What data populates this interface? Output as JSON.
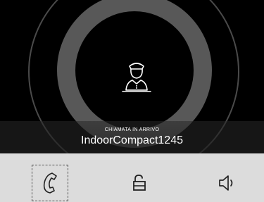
{
  "call": {
    "status_label": "CHIAMATA IN ARRIVO",
    "caller_name": "IndoorCompact1245"
  },
  "actions": {
    "answer_icon": "phone-handset-icon",
    "unlock_icon": "unlock-padlock-icon",
    "speaker_icon": "speaker-icon"
  },
  "colors": {
    "background": "#000000",
    "ring": "#585858",
    "action_bar": "#dcdcdc",
    "icon": "#222222"
  }
}
